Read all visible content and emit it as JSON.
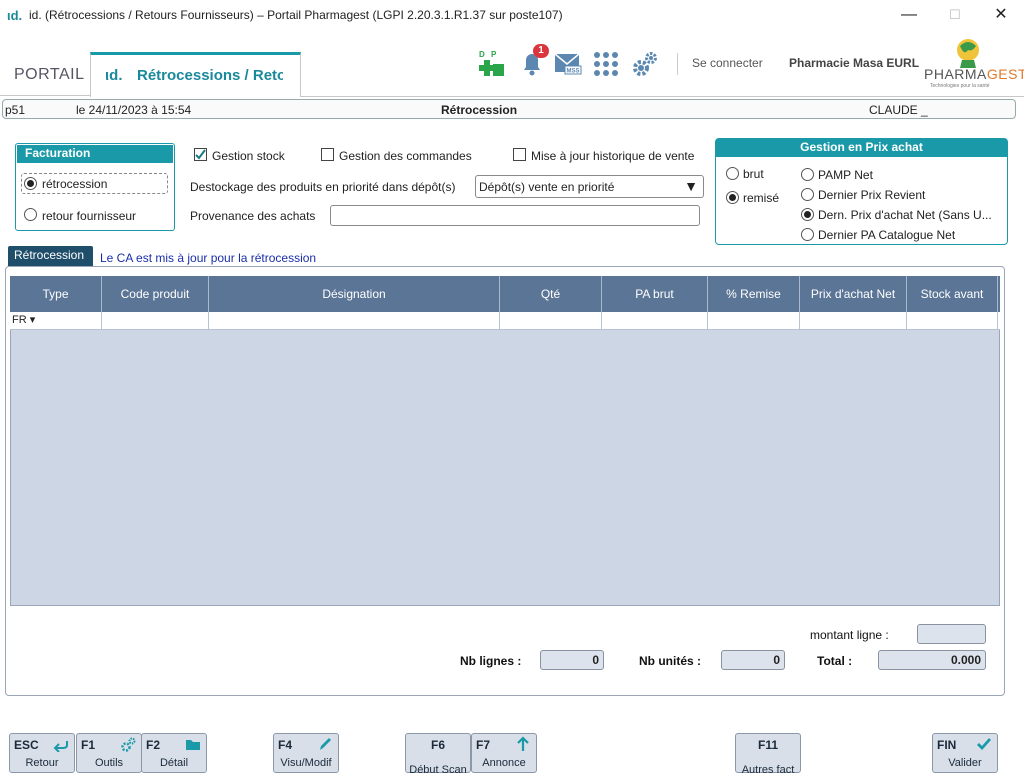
{
  "window": {
    "logo": "ιd.",
    "title": "id. (Rétrocessions / Retours Fournisseurs) – Portail Pharmagest (LGPI 2.20.3.1.R1.37 sur poste107)",
    "minimize": "—",
    "maximize": "☐",
    "close": "✕"
  },
  "tabs": {
    "portail": "PORTAIL",
    "active_icon": "ιd.",
    "active": "Rétrocessions / Retours Fournisseurs"
  },
  "header": {
    "dp_icon": "dp-plus-icon",
    "notification_count": "1",
    "connect": "Se connecter",
    "pharmacy": "Pharmacie Masa EURL",
    "brand_a": "PHARMA",
    "brand_b": "GEST",
    "brand_sub": "Technologies pour la santé"
  },
  "status": {
    "poste": "p51",
    "date": "le 24/11/2023 à 15:54",
    "mode": "Rétrocession",
    "user": "CLAUDE _"
  },
  "facturation": {
    "title": "Facturation",
    "option1": "rétrocession",
    "option2": "retour fournisseur",
    "selected": "rétrocession"
  },
  "options": {
    "gestion_stock": "Gestion stock",
    "gestion_stock_checked": true,
    "gestion_commandes": "Gestion des commandes",
    "gestion_commandes_checked": false,
    "maj_historique": "Mise à jour historique de vente",
    "maj_historique_checked": false,
    "destockage_label": "Destockage des produits en priorité dans dépôt(s)",
    "destockage_value": "Dépôt(s) vente en priorité",
    "provenance_label": "Provenance des achats",
    "provenance_value": ""
  },
  "prix_achat": {
    "title": "Gestion en Prix achat",
    "brut": "brut",
    "remise": "remisé",
    "mode_selected": "remisé",
    "pamp": "PAMP Net",
    "dernier_revient": "Dernier Prix Revient",
    "dern_net": "Dern. Prix d'achat Net (Sans U...",
    "dernier_catalogue": "Dernier PA Catalogue Net",
    "basis_selected": "Dern. Prix d'achat Net"
  },
  "section": {
    "tab": "Rétrocession",
    "message": "Le CA est mis à jour pour la rétrocession"
  },
  "grid": {
    "columns": [
      "Type",
      "Code produit",
      "Désignation",
      "Qté",
      "PA brut",
      "% Remise",
      "Prix d'achat Net",
      "Stock avant"
    ],
    "rows": [
      [
        "FR ▾",
        "",
        "",
        "",
        "",
        "",
        "",
        ""
      ]
    ]
  },
  "totals": {
    "montant_ligne_label": "montant ligne :",
    "montant_ligne_value": "",
    "nb_lignes_label": "Nb lignes :",
    "nb_lignes_value": "0",
    "nb_unites_label": "Nb unités :",
    "nb_unites_value": "0",
    "total_label": "Total :",
    "total_value": "0.000"
  },
  "fkeys": [
    {
      "key": "ESC",
      "label": "Retour",
      "icon": "return-arrow-icon"
    },
    {
      "key": "F1",
      "label": "Outils",
      "icon": "gears-icon"
    },
    {
      "key": "F2",
      "label": "Détail",
      "icon": "folder-icon"
    },
    {
      "key": "F4",
      "label": "Visu/Modif",
      "icon": "pencil-icon"
    },
    {
      "key": "F6",
      "label": "Début Scan",
      "icon": ""
    },
    {
      "key": "F7",
      "label": "Annonce",
      "icon": "arrow-up-icon"
    },
    {
      "key": "F11",
      "label": "Autres fact",
      "icon": ""
    },
    {
      "key": "FIN",
      "label": "Valider",
      "icon": "checkmark-icon"
    }
  ],
  "colors": {
    "accent": "#1a9aa8",
    "grid_header": "#5b7596",
    "grid_body": "#cdd6e5",
    "section_tab": "#1f4e6b",
    "badge": "#d9363e",
    "dp_green": "#2aa54a"
  }
}
